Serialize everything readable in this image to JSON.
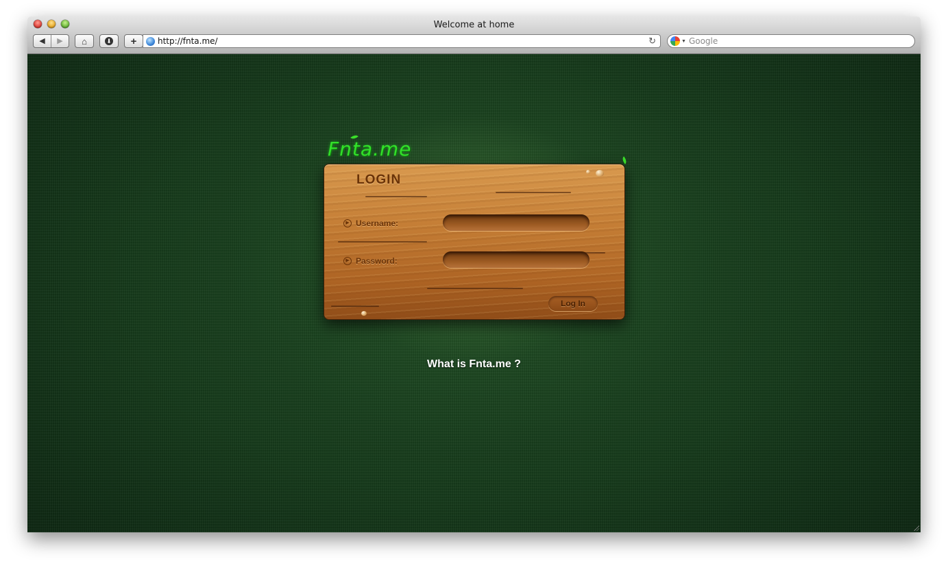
{
  "window": {
    "title": "Welcome at home"
  },
  "toolbar": {
    "back_icon": "back-arrow-icon",
    "forward_icon": "forward-arrow-icon",
    "home_icon": "home-icon",
    "download_icon": "download-icon",
    "add_icon": "add-icon",
    "url": "http://fnta.me/",
    "reload_icon": "reload-icon",
    "search_placeholder": "Google"
  },
  "page": {
    "logo_text": "Fnta.me",
    "panel_title": "LOGIN",
    "username_label": "Username:",
    "password_label": "Password:",
    "username_value": "",
    "password_value": "",
    "login_button": "Log In",
    "what_is_link": "What is Fnta.me ?"
  },
  "colors": {
    "background": "#163a1b",
    "wood": "#c47d35",
    "wood_text": "#6a3308",
    "logo": "#33e02a"
  }
}
